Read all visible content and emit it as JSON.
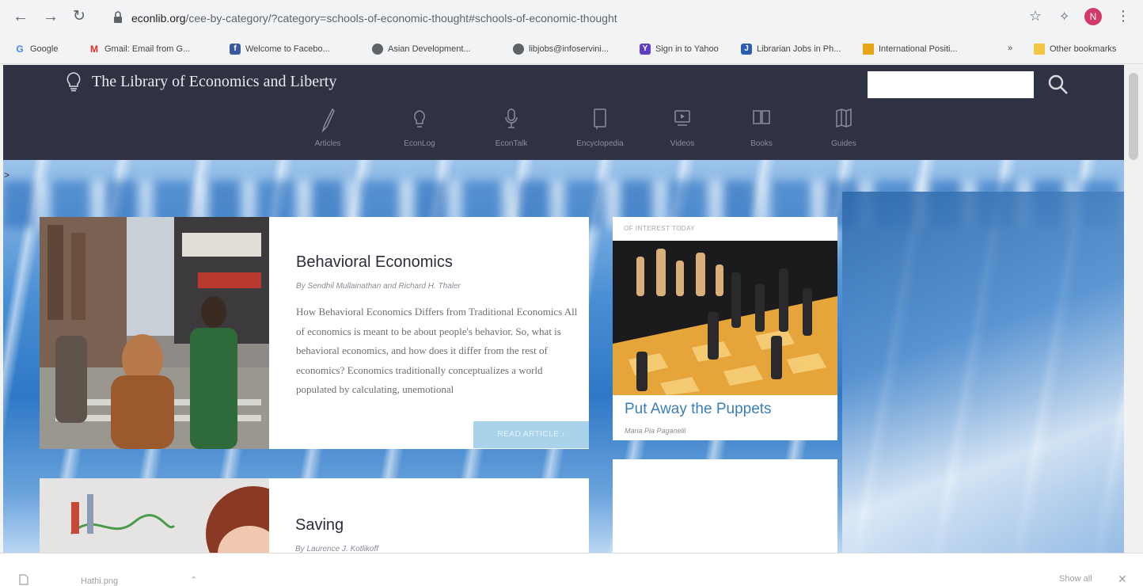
{
  "browser": {
    "url_host": "econlib.org",
    "url_path": "/cee-by-category/?category=schools-of-economic-thought#schools-of-economic-thought",
    "avatar_letter": "N"
  },
  "bookmarks": [
    {
      "label": "Google",
      "icon": "google-icon",
      "color": "#4285f4",
      "glyph": "G"
    },
    {
      "label": "Gmail: Email from G...",
      "icon": "gmail-icon",
      "color": "#d93025",
      "glyph": "M"
    },
    {
      "label": "Welcome to Facebo...",
      "icon": "facebook-icon",
      "color": "#3b5998",
      "glyph": "f"
    },
    {
      "label": "Asian Development...",
      "icon": "globe-icon",
      "color": "#5f6368",
      "glyph": ""
    },
    {
      "label": "libjobs@infoservini...",
      "icon": "globe-icon",
      "color": "#5f6368",
      "glyph": ""
    },
    {
      "label": "Sign in to Yahoo",
      "icon": "yahoo-icon",
      "color": "#5f3dc4",
      "glyph": "Y"
    },
    {
      "label": "Librarian Jobs in Ph...",
      "icon": "jobs-icon",
      "color": "#2a5db0",
      "glyph": "J"
    },
    {
      "label": "International Positi...",
      "icon": "folder-icon",
      "color": "#e8a317",
      "glyph": ""
    },
    {
      "label": "»",
      "icon": "overflow-icon",
      "color": "#5f6368",
      "glyph": ""
    },
    {
      "label": "Other bookmarks",
      "icon": "folder-icon",
      "color": "#f4c542",
      "glyph": ""
    }
  ],
  "site": {
    "title": "The Library of Economics and Liberty",
    "search_placeholder": "",
    "nav": [
      {
        "label": "Articles",
        "icon": "pen-icon"
      },
      {
        "label": "EconLog",
        "icon": "lightbulb-icon"
      },
      {
        "label": "EconTalk",
        "icon": "microphone-icon"
      },
      {
        "label": "Encyclopedia",
        "icon": "book-icon"
      },
      {
        "label": "Videos",
        "icon": "video-icon"
      },
      {
        "label": "Books",
        "icon": "open-book-icon"
      },
      {
        "label": "Guides",
        "icon": "map-icon"
      }
    ]
  },
  "featured": {
    "title": "Behavioral Economics",
    "author": "By Sendhil Mullainathan and Richard H. Thaler",
    "excerpt": "How Behavioral Economics Differs from Traditional Economics All of economics is meant to be about people's behavior. So, what is behavioral economics, and how does it differ from the rest of economics? Economics traditionally conceptualizes a world populated by calculating, unemotional",
    "button": "READ ARTICLE ›"
  },
  "interest": {
    "label": "OF INTEREST TODAY",
    "title": "Put Away the Puppets",
    "author": "Maria Pia Paganelli"
  },
  "second": {
    "title": "Saving",
    "author": "By Laurence J. Kotlikoff"
  },
  "downloads": {
    "file": "Hathi.png",
    "show_all": "Show all"
  }
}
